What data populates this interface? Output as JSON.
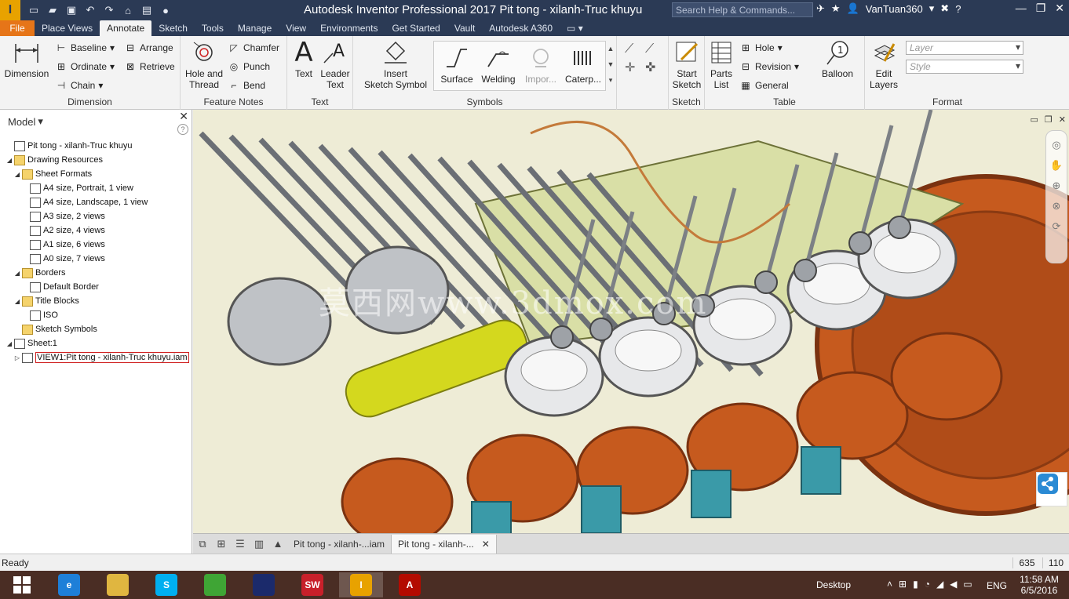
{
  "window": {
    "logo_letter": "I",
    "title": "Autodesk Inventor Professional 2017    Pit tong - xilanh-Truc khuyu",
    "search_placeholder": "Search Help & Commands...",
    "user": "VanTuan360",
    "qat_icons": [
      "new-icon",
      "open-icon",
      "save-icon",
      "undo-icon",
      "redo-icon",
      "home-icon",
      "print-icon",
      "update-icon"
    ]
  },
  "ribbon_tabs": [
    {
      "label": "File",
      "kind": "file"
    },
    {
      "label": "Place Views"
    },
    {
      "label": "Annotate",
      "active": true
    },
    {
      "label": "Sketch"
    },
    {
      "label": "Tools"
    },
    {
      "label": "Manage"
    },
    {
      "label": "View"
    },
    {
      "label": "Environments"
    },
    {
      "label": "Get Started"
    },
    {
      "label": "Vault"
    },
    {
      "label": "Autodesk A360"
    }
  ],
  "ribbon": {
    "dimension": {
      "label": "Dimension",
      "dimension_btn": "Dimension",
      "baseline": "Baseline",
      "ordinate": "Ordinate",
      "chain": "Chain",
      "arrange": "Arrange",
      "retrieve": "Retrieve"
    },
    "feature_notes": {
      "label": "Feature Notes",
      "hole_thread_1": "Hole and",
      "hole_thread_2": "Thread",
      "chamfer": "Chamfer",
      "punch": "Punch",
      "bend": "Bend"
    },
    "text": {
      "label": "Text",
      "text_btn": "Text",
      "leader_1": "Leader",
      "leader_2": "Text"
    },
    "symbols": {
      "label": "Symbols",
      "insert_1": "Insert",
      "insert_2": "Sketch Symbol",
      "surface": "Surface",
      "welding": "Welding",
      "import": "Impor...",
      "caterpillar": "Caterp..."
    },
    "sketch": {
      "label": "Sketch",
      "start_1": "Start",
      "start_2": "Sketch"
    },
    "table": {
      "label": "Table",
      "parts_1": "Parts",
      "parts_2": "List",
      "hole": "Hole",
      "revision": "Revision",
      "general": "General",
      "balloon": "Balloon"
    },
    "format": {
      "label": "Format",
      "edit_1": "Edit",
      "edit_2": "Layers",
      "layer_placeholder": "Layer",
      "style_placeholder": "Style"
    }
  },
  "browser": {
    "title": "Model",
    "close": "✕",
    "help": "?",
    "nodes": [
      {
        "label": "Pit tong - xilanh-Truc khuyu",
        "level": 0,
        "twisty": "",
        "icon": "drawing"
      },
      {
        "label": "Drawing Resources",
        "level": 0,
        "twisty": "◢",
        "icon": "folder"
      },
      {
        "label": "Sheet Formats",
        "level": 1,
        "twisty": "◢",
        "icon": "folder"
      },
      {
        "label": "A4 size, Portrait, 1 view",
        "level": 2,
        "twisty": "",
        "icon": "sheet"
      },
      {
        "label": "A4 size, Landscape, 1 view",
        "level": 2,
        "twisty": "",
        "icon": "sheet"
      },
      {
        "label": "A3 size, 2 views",
        "level": 2,
        "twisty": "",
        "icon": "sheet"
      },
      {
        "label": "A2 size, 4 views",
        "level": 2,
        "twisty": "",
        "icon": "sheet"
      },
      {
        "label": "A1 size, 6 views",
        "level": 2,
        "twisty": "",
        "icon": "sheet"
      },
      {
        "label": "A0 size, 7 views",
        "level": 2,
        "twisty": "",
        "icon": "sheet"
      },
      {
        "label": "Borders",
        "level": 1,
        "twisty": "◢",
        "icon": "folder"
      },
      {
        "label": "Default Border",
        "level": 2,
        "twisty": "",
        "icon": "sheet"
      },
      {
        "label": "Title Blocks",
        "level": 1,
        "twisty": "◢",
        "icon": "folder"
      },
      {
        "label": "ISO",
        "level": 2,
        "twisty": "",
        "icon": "sheet"
      },
      {
        "label": "Sketch Symbols",
        "level": 1,
        "twisty": "",
        "icon": "folder"
      },
      {
        "label": "Sheet:1",
        "level": 0,
        "twisty": "◢",
        "icon": "sheet"
      },
      {
        "label": "VIEW1:Pit tong - xilanh-Truc khuyu.iam",
        "level": 1,
        "twisty": "▷",
        "icon": "view",
        "selected": true
      }
    ]
  },
  "viewport": {
    "watermark": "莫西网www.3dmox.com"
  },
  "doc_tabs": [
    {
      "label": "Pit tong - xilanh-...iam",
      "active": false
    },
    {
      "label": "Pit tong - xilanh-...",
      "active": true
    }
  ],
  "status": {
    "text": "Ready",
    "count1": "635",
    "count2": "110"
  },
  "taskbar": {
    "apps": [
      {
        "name": "start",
        "icon": "windows-icon",
        "label": ""
      },
      {
        "name": "ie",
        "icon": "ie-icon",
        "label": "e"
      },
      {
        "name": "explorer",
        "icon": "folder-icon",
        "label": ""
      },
      {
        "name": "skype",
        "icon": "skype-icon",
        "label": "S"
      },
      {
        "name": "coccoc",
        "icon": "browser-icon",
        "label": ""
      },
      {
        "name": "photo",
        "icon": "app-icon",
        "label": ""
      },
      {
        "name": "solidworks",
        "icon": "solidworks-icon",
        "label": "SW"
      },
      {
        "name": "inventor",
        "icon": "inventor-icon",
        "label": "I",
        "active": true
      },
      {
        "name": "acrobat",
        "icon": "pdf-icon",
        "label": "A"
      }
    ],
    "desktop": "Desktop",
    "language": "ENG",
    "time": "11:58 AM",
    "date": "6/5/2016"
  },
  "colors": {
    "title_bar": "#2b3a55",
    "file_tab": "#e67518",
    "taskbar": "#4a2d24",
    "flywheel": "#c65a1e",
    "camshaft": "#d4d81e"
  }
}
